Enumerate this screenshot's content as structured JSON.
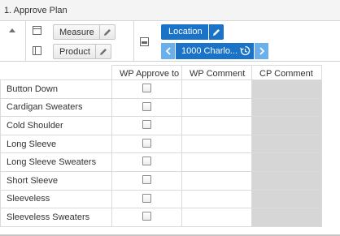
{
  "window": {
    "title": "1. Approve Plan"
  },
  "pivot": {
    "row_dimensions": [
      {
        "label": "Measure"
      },
      {
        "label": "Product"
      }
    ],
    "column_dimension": {
      "label": "Location"
    },
    "page": {
      "value": "1000 Charlo..."
    }
  },
  "grid": {
    "columns": [
      "WP Approve to",
      "WP Comment",
      "CP Comment"
    ],
    "rows": [
      {
        "label": "Button Down",
        "approved": false,
        "wp_comment": "",
        "cp_comment": ""
      },
      {
        "label": "Cardigan Sweaters",
        "approved": false,
        "wp_comment": "",
        "cp_comment": ""
      },
      {
        "label": "Cold Shoulder",
        "approved": false,
        "wp_comment": "",
        "cp_comment": ""
      },
      {
        "label": "Long Sleeve",
        "approved": false,
        "wp_comment": "",
        "cp_comment": ""
      },
      {
        "label": "Long Sleeve Sweaters",
        "approved": false,
        "wp_comment": "",
        "cp_comment": ""
      },
      {
        "label": "Short Sleeve",
        "approved": false,
        "wp_comment": "",
        "cp_comment": ""
      },
      {
        "label": "Sleeveless",
        "approved": false,
        "wp_comment": "",
        "cp_comment": ""
      },
      {
        "label": "Sleeveless Sweaters",
        "approved": false,
        "wp_comment": "",
        "cp_comment": ""
      }
    ]
  },
  "colors": {
    "accent": "#1a73c7",
    "accent_light": "#6ab0ea",
    "readonly_cell": "#d6d6d6"
  },
  "icons": {
    "collapse": "triangle-up-icon",
    "edit": "pencil-icon",
    "prev": "chevron-left-icon",
    "next": "chevron-right-icon",
    "history": "history-icon"
  }
}
